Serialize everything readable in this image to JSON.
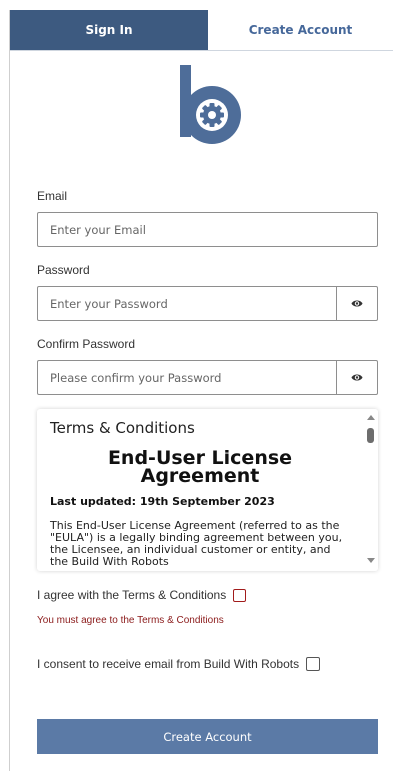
{
  "tabs": {
    "signin": "Sign In",
    "create": "Create Account"
  },
  "form": {
    "email_label": "Email",
    "email_placeholder": "Enter your Email",
    "password_label": "Password",
    "password_placeholder": "Enter your Password",
    "confirm_label": "Confirm Password",
    "confirm_placeholder": "Please confirm your Password"
  },
  "terms": {
    "heading": "Terms & Conditions",
    "title": "End-User License Agreement",
    "updated": "Last updated: 19th September 2023",
    "body": "This End-User License Agreement (referred to as the \"EULA\") is a legally binding agreement between you, the Licensee, an individual customer or entity, and the Build With Robots"
  },
  "agree": {
    "label": "I agree with the Terms & Conditions",
    "error": "You must agree to the Terms & Conditions"
  },
  "consent": {
    "label": "I consent to receive email from Build With Robots"
  },
  "submit_label": "Create Account",
  "colors": {
    "brand_dark": "#3d5a80",
    "brand_button": "#5b7aa6",
    "logo": "#4e6d99",
    "error": "#8b1a1a"
  },
  "icons": {
    "password_toggle": "eye-icon",
    "confirm_toggle": "eye-icon"
  }
}
